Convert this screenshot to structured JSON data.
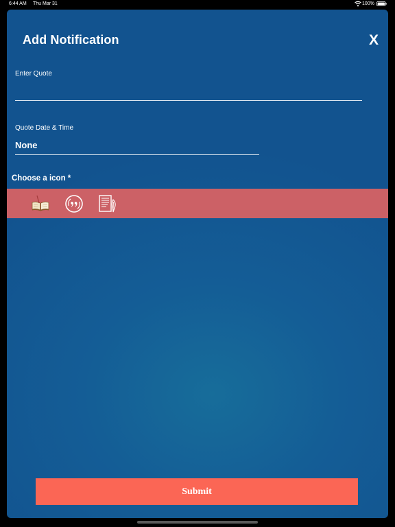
{
  "status_bar": {
    "time": "6:44 AM",
    "date": "Thu Mar 31",
    "battery_percent": "100%",
    "wifi_icon": "wifi-icon",
    "battery_icon": "battery-full-icon"
  },
  "modal": {
    "title": "Add Notification",
    "close_label": "X",
    "quote_field": {
      "label": "Enter Quote",
      "value": "",
      "placeholder": ""
    },
    "date_field": {
      "label": "Quote Date & Time",
      "value": "None"
    },
    "choose_icon_label": "Choose a icon *",
    "icon_choices": [
      {
        "icon": "open-book-icon"
      },
      {
        "icon": "quote-circle-icon"
      },
      {
        "icon": "document-quill-icon"
      }
    ],
    "submit_label": "Submit"
  },
  "colors": {
    "modal_background": "#12538f",
    "icon_strip": "#cc6166",
    "submit_button": "#fb6655",
    "text": "#ffffff"
  }
}
